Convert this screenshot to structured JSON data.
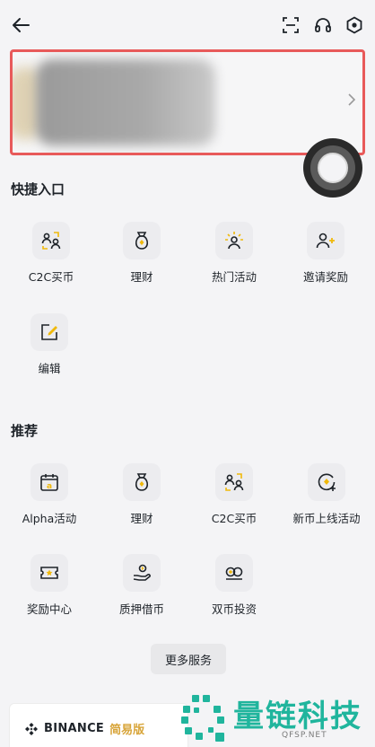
{
  "header": {
    "back_icon": "arrow-left-icon",
    "scan_icon": "scan-icon",
    "support_icon": "headset-icon",
    "settings_icon": "hex-settings-icon"
  },
  "profile": {
    "redacted": true,
    "chevron_icon": "chevron-right-icon"
  },
  "quick_entry": {
    "title": "快捷入口",
    "items": [
      {
        "label": "C2C买币",
        "icon": "p2p-icon"
      },
      {
        "label": "理财",
        "icon": "money-bag-icon"
      },
      {
        "label": "热门活动",
        "icon": "sun-person-icon"
      },
      {
        "label": "邀请奖励",
        "icon": "add-user-icon"
      },
      {
        "label": "编辑",
        "icon": "edit-icon"
      }
    ]
  },
  "recommend": {
    "title": "推荐",
    "items": [
      {
        "label": "Alpha活动",
        "icon": "alpha-calendar-icon"
      },
      {
        "label": "理财",
        "icon": "money-bag-icon"
      },
      {
        "label": "C2C买币",
        "icon": "p2p-icon"
      },
      {
        "label": "新币上线活动",
        "icon": "new-coin-icon"
      },
      {
        "label": "奖励中心",
        "icon": "reward-ticket-icon"
      },
      {
        "label": "质押借币",
        "icon": "loan-hand-icon"
      },
      {
        "label": "双币投资",
        "icon": "dual-coin-icon"
      }
    ]
  },
  "more_services": "更多服务",
  "footer": {
    "brand": "BINANCE",
    "edition": "简易版"
  },
  "watermark": {
    "text": "量链科技",
    "sub": "QFSP.NET"
  },
  "colors": {
    "accent": "#F0B90B",
    "highlight_border": "#E85A5A",
    "watermark": "#20B59D"
  }
}
